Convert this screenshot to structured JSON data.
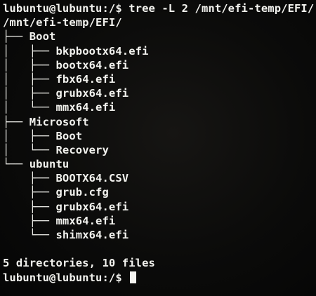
{
  "terminal": {
    "command_line": "lubuntu@lubuntu:/$ tree -L 2 /mnt/efi-temp/EFI/",
    "root_path": "/mnt/efi-temp/EFI/",
    "tree": [
      {
        "prefix": "├── ",
        "name": "Boot"
      },
      {
        "prefix": "│   ├── ",
        "name": "bkpbootx64.efi"
      },
      {
        "prefix": "│   ├── ",
        "name": "bootx64.efi"
      },
      {
        "prefix": "│   ├── ",
        "name": "fbx64.efi"
      },
      {
        "prefix": "│   ├── ",
        "name": "grubx64.efi"
      },
      {
        "prefix": "│   └── ",
        "name": "mmx64.efi"
      },
      {
        "prefix": "├── ",
        "name": "Microsoft"
      },
      {
        "prefix": "│   ├── ",
        "name": "Boot"
      },
      {
        "prefix": "│   └── ",
        "name": "Recovery"
      },
      {
        "prefix": "└── ",
        "name": "ubuntu"
      },
      {
        "prefix": "    ├── ",
        "name": "BOOTX64.CSV"
      },
      {
        "prefix": "    ├── ",
        "name": "grub.cfg"
      },
      {
        "prefix": "    ├── ",
        "name": "grubx64.efi"
      },
      {
        "prefix": "    ├── ",
        "name": "mmx64.efi"
      },
      {
        "prefix": "    └── ",
        "name": "shimx64.efi"
      }
    ],
    "summary": "5 directories, 10 files",
    "prompt": "lubuntu@lubuntu:/$ "
  }
}
